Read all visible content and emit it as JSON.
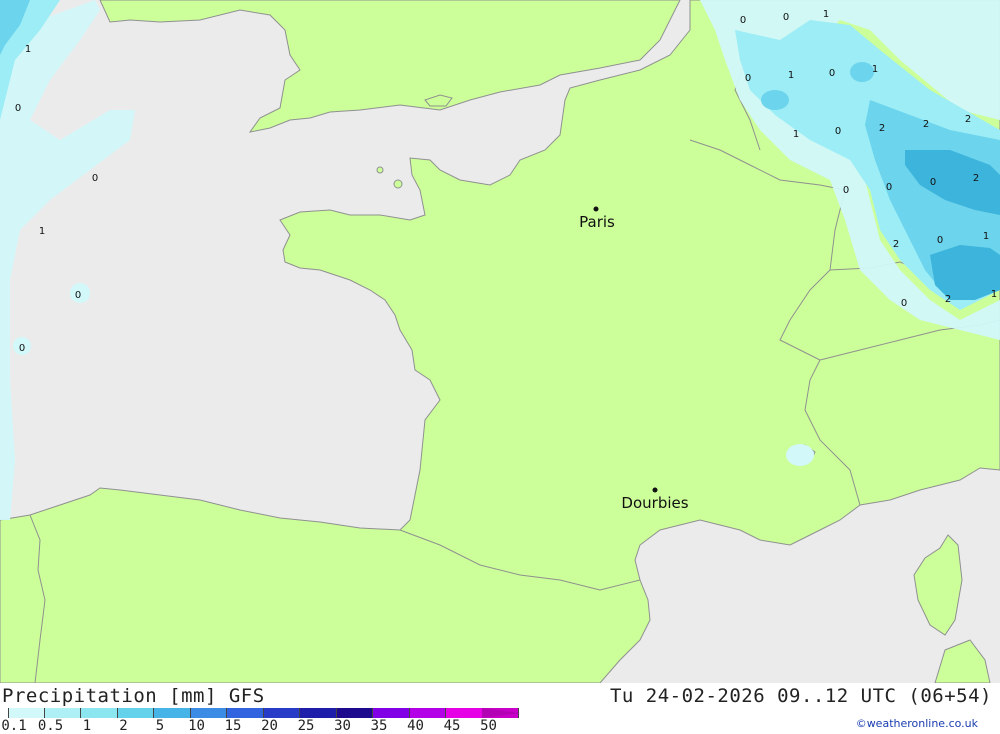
{
  "map": {
    "colors": {
      "sea": "#ebebeb",
      "land": "#ccff99",
      "border": "#909090",
      "precip_light": "#d2f8fa",
      "precip_mid": "#9cedf5",
      "precip_high": "#6cd4ec",
      "precip_top": "#3cb4dc"
    },
    "cities": [
      {
        "name": "Paris"
      },
      {
        "name": "Dourbies"
      }
    ],
    "amounts": [
      "1",
      "0",
      "0",
      "1",
      "0",
      "0",
      "0",
      "0",
      "1",
      "0",
      "1",
      "0",
      "1",
      "1",
      "0",
      "2",
      "2",
      "2",
      "0",
      "0",
      "2",
      "0",
      "2",
      "0",
      "1",
      "0"
    ]
  },
  "footer": {
    "title_left": "Precipitation [mm] GFS",
    "title_right": "Tu 24-02-2026 09..12 UTC (06+54)",
    "credit": "©weatheronline.co.uk",
    "legend": [
      {
        "label": "0.1",
        "color": "#d2f8fa"
      },
      {
        "label": "0.5",
        "color": "#aef0f5"
      },
      {
        "label": "1",
        "color": "#8ce6f0"
      },
      {
        "label": "2",
        "color": "#64d2ea"
      },
      {
        "label": "5",
        "color": "#46b4e6"
      },
      {
        "label": "10",
        "color": "#3c8ce6"
      },
      {
        "label": "15",
        "color": "#3264e0"
      },
      {
        "label": "20",
        "color": "#283cc8"
      },
      {
        "label": "25",
        "color": "#1e1eaa"
      },
      {
        "label": "30",
        "color": "#1e0a8c"
      },
      {
        "label": "35",
        "color": "#8200e6"
      },
      {
        "label": "40",
        "color": "#b400e6"
      },
      {
        "label": "45",
        "color": "#e600e6"
      },
      {
        "label": "50",
        "color": "#c800c8"
      }
    ]
  }
}
